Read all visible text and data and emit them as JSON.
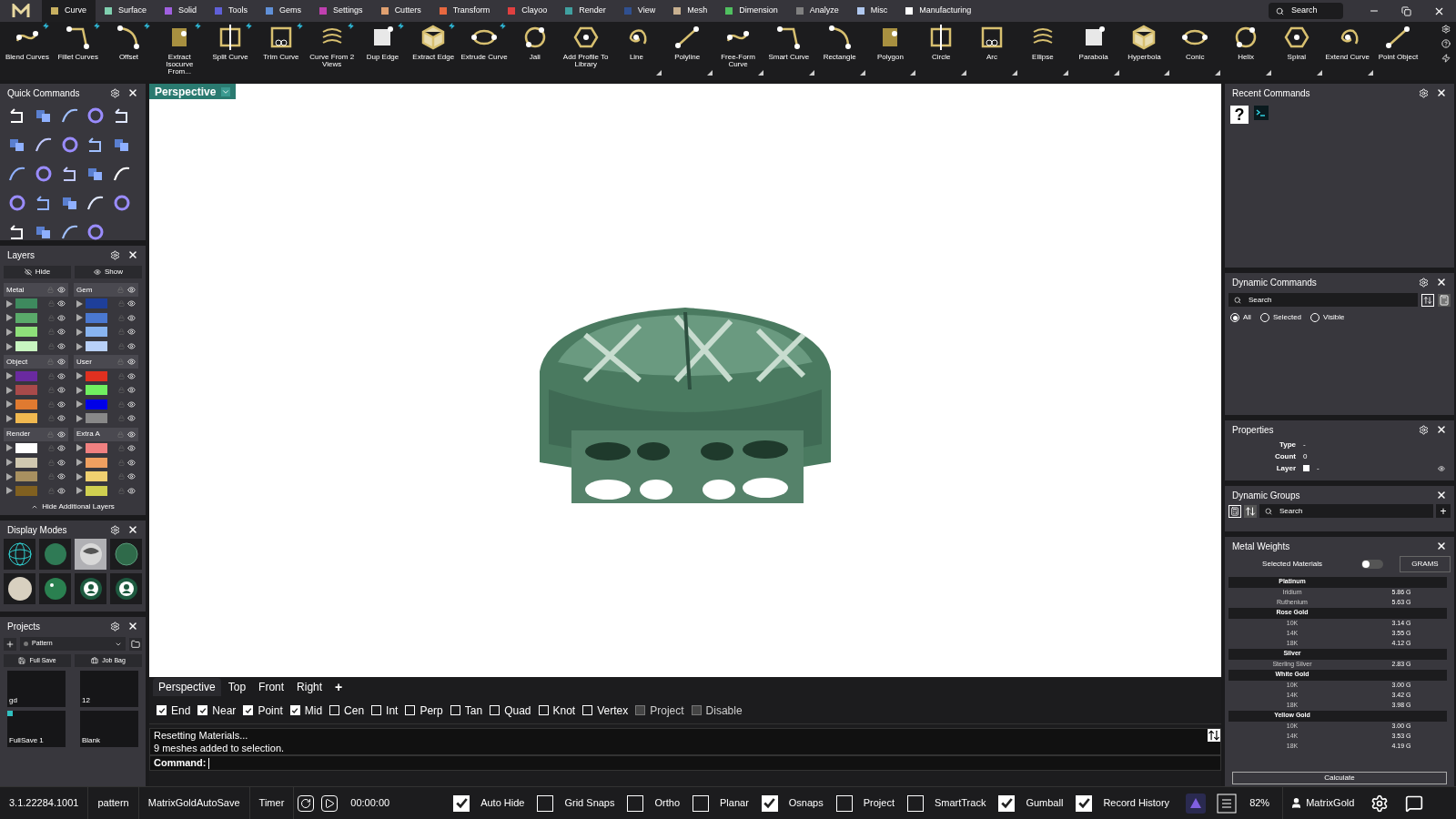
{
  "menu_tabs": [
    {
      "label": "Curve",
      "color": "#c8b060",
      "selected": true
    },
    {
      "label": "Surface",
      "color": "#80d0b0",
      "selected": false
    },
    {
      "label": "Solid",
      "color": "#a060e0",
      "selected": false
    },
    {
      "label": "Tools",
      "color": "#6060d8",
      "selected": false
    },
    {
      "label": "Gems",
      "color": "#6090d8",
      "selected": false
    },
    {
      "label": "Settings",
      "color": "#c040b0",
      "selected": false
    },
    {
      "label": "Cutters",
      "color": "#e0a070",
      "selected": false
    },
    {
      "label": "Transform",
      "color": "#e86840",
      "selected": false
    },
    {
      "label": "Clayoo",
      "color": "#e04040",
      "selected": false
    },
    {
      "label": "Render",
      "color": "#40a0a0",
      "selected": false
    },
    {
      "label": "View",
      "color": "#305090",
      "selected": false
    },
    {
      "label": "Mesh",
      "color": "#c8b090",
      "selected": false
    },
    {
      "label": "Dimension",
      "color": "#50c060",
      "selected": false
    },
    {
      "label": "Analyze",
      "color": "#808080",
      "selected": false
    },
    {
      "label": "Misc",
      "color": "#b0c8f0",
      "selected": false
    },
    {
      "label": "Manufacturing",
      "color": "#ffffff",
      "selected": false
    }
  ],
  "search": {
    "placeholder": "Search"
  },
  "toolbar": [
    {
      "label": "Blend Curves",
      "bolt": true,
      "menu": false
    },
    {
      "label": "Fillet Curves",
      "bolt": true,
      "menu": false
    },
    {
      "label": "Offset",
      "bolt": true,
      "menu": false
    },
    {
      "label": "Extract Isocurve From...",
      "bolt": true,
      "menu": false
    },
    {
      "label": "Split Curve",
      "bolt": true,
      "menu": false
    },
    {
      "label": "Trim Curve",
      "bolt": true,
      "menu": false
    },
    {
      "label": "Curve From 2 Views",
      "bolt": true,
      "menu": false
    },
    {
      "label": "Dup Edge",
      "bolt": true,
      "menu": false
    },
    {
      "label": "Extract Edge",
      "bolt": true,
      "menu": false
    },
    {
      "label": "Extrude Curve",
      "bolt": true,
      "menu": false
    },
    {
      "label": "Jali",
      "bolt": false,
      "menu": false
    },
    {
      "label": "Add Profile To Library",
      "bolt": false,
      "menu": false
    },
    {
      "label": "Line",
      "bolt": false,
      "menu": true
    },
    {
      "label": "Polyline",
      "bolt": false,
      "menu": true
    },
    {
      "label": "Free-Form Curve",
      "bolt": false,
      "menu": true
    },
    {
      "label": "Smart Curve",
      "bolt": false,
      "menu": true
    },
    {
      "label": "Rectangle",
      "bolt": false,
      "menu": true
    },
    {
      "label": "Polygon",
      "bolt": false,
      "menu": true
    },
    {
      "label": "Circle",
      "bolt": false,
      "menu": true
    },
    {
      "label": "Arc",
      "bolt": false,
      "menu": true
    },
    {
      "label": "Ellipse",
      "bolt": false,
      "menu": true
    },
    {
      "label": "Parabola",
      "bolt": false,
      "menu": true
    },
    {
      "label": "Hyperbola",
      "bolt": false,
      "menu": true
    },
    {
      "label": "Conic",
      "bolt": false,
      "menu": true
    },
    {
      "label": "Helix",
      "bolt": false,
      "menu": true
    },
    {
      "label": "Spiral",
      "bolt": false,
      "menu": true
    },
    {
      "label": "Extend Curve",
      "bolt": false,
      "menu": true
    },
    {
      "label": "Point Object",
      "bolt": false,
      "menu": false
    }
  ],
  "quick_commands": {
    "title": "Quick Commands"
  },
  "layers": {
    "title": "Layers",
    "hide_button": "Hide",
    "show_button": "Show",
    "footer": "Hide Additional Layers",
    "groups": [
      {
        "name": "Metal",
        "swatches": [
          {
            "color": "#3e8a5e"
          },
          {
            "color": "#5aaa6a"
          },
          {
            "color": "#8ee07a"
          },
          {
            "color": "#c8f5c0"
          }
        ]
      },
      {
        "name": "Gem",
        "swatches": [
          {
            "color": "#1e3f9a"
          },
          {
            "color": "#4a78d0"
          },
          {
            "color": "#88b4f0"
          },
          {
            "color": "#b8d0f8"
          }
        ]
      },
      {
        "name": "Object",
        "swatches": [
          {
            "color": "#6a2aa0"
          },
          {
            "color": "#a84a4a"
          },
          {
            "color": "#e07a30"
          },
          {
            "color": "#f0b850"
          }
        ]
      },
      {
        "name": "User",
        "swatches": [
          {
            "color": "#e03020"
          },
          {
            "color": "#70f060"
          },
          {
            "color": "#0000e8"
          },
          {
            "color": "#888888"
          }
        ]
      },
      {
        "name": "Render",
        "swatches": [
          {
            "color": "#ffffff"
          },
          {
            "color": "#d0c8b0"
          },
          {
            "color": "#a89060"
          },
          {
            "color": "#806020"
          }
        ]
      },
      {
        "name": "Extra A",
        "swatches": [
          {
            "color": "#f08080"
          },
          {
            "color": "#f0a060"
          },
          {
            "color": "#f0d070"
          },
          {
            "color": "#d0d050"
          }
        ]
      }
    ]
  },
  "display_modes": {
    "title": "Display Modes",
    "modes": [
      {
        "kind": "wireframe",
        "selected": false
      },
      {
        "kind": "shaded",
        "selected": false
      },
      {
        "kind": "chrome",
        "selected": true
      },
      {
        "kind": "ghosted",
        "selected": false
      },
      {
        "kind": "clay",
        "selected": false
      },
      {
        "kind": "glossy",
        "selected": false
      },
      {
        "kind": "user",
        "selected": false
      },
      {
        "kind": "user",
        "selected": false
      }
    ]
  },
  "projects": {
    "title": "Projects",
    "dropdown": "Pattern",
    "full_save_button": "Full Save",
    "job_bag_button": "Job Bag",
    "items": [
      {
        "label": "gd",
        "marked": false
      },
      {
        "label": "12",
        "marked": false
      },
      {
        "label": "FullSave 1",
        "marked": true
      },
      {
        "label": "Blank",
        "marked": false
      }
    ]
  },
  "viewport": {
    "title": "Perspective"
  },
  "view_tabs": [
    {
      "label": "Perspective",
      "selected": true
    },
    {
      "label": "Top",
      "selected": false
    },
    {
      "label": "Front",
      "selected": false
    },
    {
      "label": "Right",
      "selected": false
    }
  ],
  "add_view": "+",
  "snaps": [
    {
      "label": "End",
      "checked": true,
      "disabled": false
    },
    {
      "label": "Near",
      "checked": true,
      "disabled": false
    },
    {
      "label": "Point",
      "checked": true,
      "disabled": false
    },
    {
      "label": "Mid",
      "checked": true,
      "disabled": false
    },
    {
      "label": "Cen",
      "checked": false,
      "disabled": false
    },
    {
      "label": "Int",
      "checked": false,
      "disabled": false
    },
    {
      "label": "Perp",
      "checked": false,
      "disabled": false
    },
    {
      "label": "Tan",
      "checked": false,
      "disabled": false
    },
    {
      "label": "Quad",
      "checked": false,
      "disabled": false
    },
    {
      "label": "Knot",
      "checked": false,
      "disabled": false
    },
    {
      "label": "Vertex",
      "checked": false,
      "disabled": false
    },
    {
      "label": "Project",
      "checked": false,
      "disabled": true
    },
    {
      "label": "Disable",
      "checked": false,
      "disabled": true
    }
  ],
  "command_log": [
    "Resetting Materials...",
    "9 meshes added to selection."
  ],
  "command_prompt": "Command:",
  "status_bar": {
    "version": "3.1.22284.1001",
    "file": "pattern",
    "autosave": "MatrixGoldAutoSave",
    "timer_label": "Timer",
    "timer": "00:00:00",
    "toggles": [
      {
        "label": "Auto Hide",
        "checked": true
      },
      {
        "label": "Grid Snaps",
        "checked": false
      },
      {
        "label": "Ortho",
        "checked": false
      },
      {
        "label": "Planar",
        "checked": false
      },
      {
        "label": "Osnaps",
        "checked": true
      },
      {
        "label": "Project",
        "checked": false
      },
      {
        "label": "SmartTrack",
        "checked": false
      },
      {
        "label": "Gumball",
        "checked": true
      },
      {
        "label": "Record History",
        "checked": true
      }
    ],
    "zoom": "82%",
    "user": "MatrixGold"
  },
  "recent_commands": {
    "title": "Recent Commands",
    "help_glyph": "?"
  },
  "dynamic_commands": {
    "title": "Dynamic Commands",
    "search_placeholder": "Search",
    "filters": [
      {
        "label": "All",
        "selected": true
      },
      {
        "label": "Selected",
        "selected": false
      },
      {
        "label": "Visible",
        "selected": false
      }
    ]
  },
  "properties": {
    "title": "Properties",
    "rows": [
      {
        "label": "Type",
        "value": "-"
      },
      {
        "label": "Count",
        "value": "0"
      },
      {
        "label": "Layer",
        "value": "-"
      }
    ]
  },
  "dynamic_groups": {
    "title": "Dynamic Groups",
    "search_placeholder": "Search",
    "add": "+"
  },
  "metal_weights": {
    "title": "Metal Weights",
    "selected_materials": "Selected Materials",
    "on": false,
    "unit_button": "GRAMS",
    "calculate_button": "Calculate",
    "rows": [
      {
        "kind": "group",
        "label": "Platinum"
      },
      {
        "kind": "item",
        "label": "Iridium",
        "value": "5.86 G"
      },
      {
        "kind": "item",
        "label": "Ruthenium",
        "value": "5.63 G"
      },
      {
        "kind": "group",
        "label": "Rose Gold"
      },
      {
        "kind": "item",
        "label": "10K",
        "value": "3.14 G"
      },
      {
        "kind": "item",
        "label": "14K",
        "value": "3.55 G"
      },
      {
        "kind": "item",
        "label": "18K",
        "value": "4.12 G"
      },
      {
        "kind": "group",
        "label": "Silver"
      },
      {
        "kind": "item",
        "label": "Sterling Silver",
        "value": "2.83 G"
      },
      {
        "kind": "group",
        "label": "White Gold"
      },
      {
        "kind": "item",
        "label": "10K",
        "value": "3.00 G"
      },
      {
        "kind": "item",
        "label": "14K",
        "value": "3.42 G"
      },
      {
        "kind": "item",
        "label": "18K",
        "value": "3.98 G"
      },
      {
        "kind": "group",
        "label": "Yellow Gold"
      },
      {
        "kind": "item",
        "label": "10K",
        "value": "3.00 G"
      },
      {
        "kind": "item",
        "label": "14K",
        "value": "3.53 G"
      },
      {
        "kind": "item",
        "label": "18K",
        "value": "4.19 G"
      }
    ]
  }
}
